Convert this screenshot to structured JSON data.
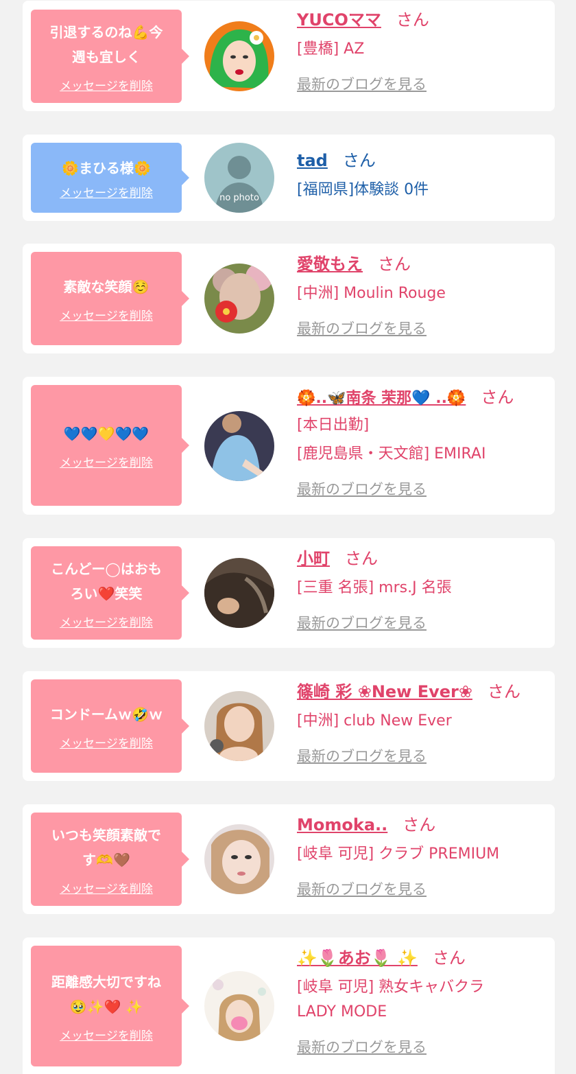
{
  "colors": {
    "accent_pink": "#e0436a",
    "bubble_pink": "#fe98a5",
    "bubble_blue": "#8ab8f8",
    "name_blue": "#1e5fa8",
    "link_gray": "#999999",
    "background": "#f2f2f2"
  },
  "san_suffix": "さん",
  "delete_label": "メッセージを削除",
  "blog_label": "最新のブログを見る",
  "entries": [
    {
      "message": "引退するのね💪今\n週も宜しく",
      "name": "YUCOママ",
      "lines": [
        "[豊橋] AZ"
      ],
      "has_blog": true,
      "theme": "pink",
      "avatar_icon": "green-hair-illustration"
    },
    {
      "message": "🌼まひる様🌼",
      "name": "tad",
      "lines": [
        "[福岡県]体験談 0件"
      ],
      "has_blog": false,
      "theme": "blue",
      "avatar_icon": "no-photo-silhouette",
      "avatar_text": "no photo"
    },
    {
      "message": "素敵な笑顔☺️",
      "name": "愛敬もえ",
      "lines": [
        "[中洲] Moulin Rouge"
      ],
      "has_blog": true,
      "theme": "pink",
      "avatar_icon": "flower-face-photo"
    },
    {
      "message": "💙💙💛💙💙",
      "name": "🏵️..🦋南条 茉那💙 ..🏵️",
      "lines": [
        "[本日出勤]",
        "[鹿児島県・天文館] EMIRAI"
      ],
      "has_blog": true,
      "theme": "pink",
      "avatar_icon": "blue-dress-photo"
    },
    {
      "message": "こんどー◯はおも\nろい❤️笑笑",
      "name": "小町",
      "lines": [
        "[三重 名張] mrs.J 名張"
      ],
      "has_blog": true,
      "theme": "pink",
      "avatar_icon": "dark-outfit-photo"
    },
    {
      "message": "コンドームｗ🤣ｗ",
      "name": "篠崎 彩 ❀New Ever❀",
      "lines": [
        "[中洲] club New Ever"
      ],
      "has_blog": true,
      "theme": "pink",
      "avatar_icon": "selfie-photo"
    },
    {
      "message": "いつも笑顔素敵で\nす🫶🤎",
      "name": "Momoka..",
      "lines": [
        "[岐阜 可児] クラブ PREMIUM"
      ],
      "has_blog": true,
      "theme": "pink",
      "avatar_icon": "closeup-selfie-photo"
    },
    {
      "message": "距離感大切ですね\n🥹✨❤️ ✨",
      "name": "✨🌷あお🌷 ✨",
      "lines": [
        "[岐阜 可児] 熟女キャバクラ",
        "LADY MODE"
      ],
      "has_blog": true,
      "theme": "pink",
      "avatar_icon": "pink-mask-photo"
    }
  ]
}
